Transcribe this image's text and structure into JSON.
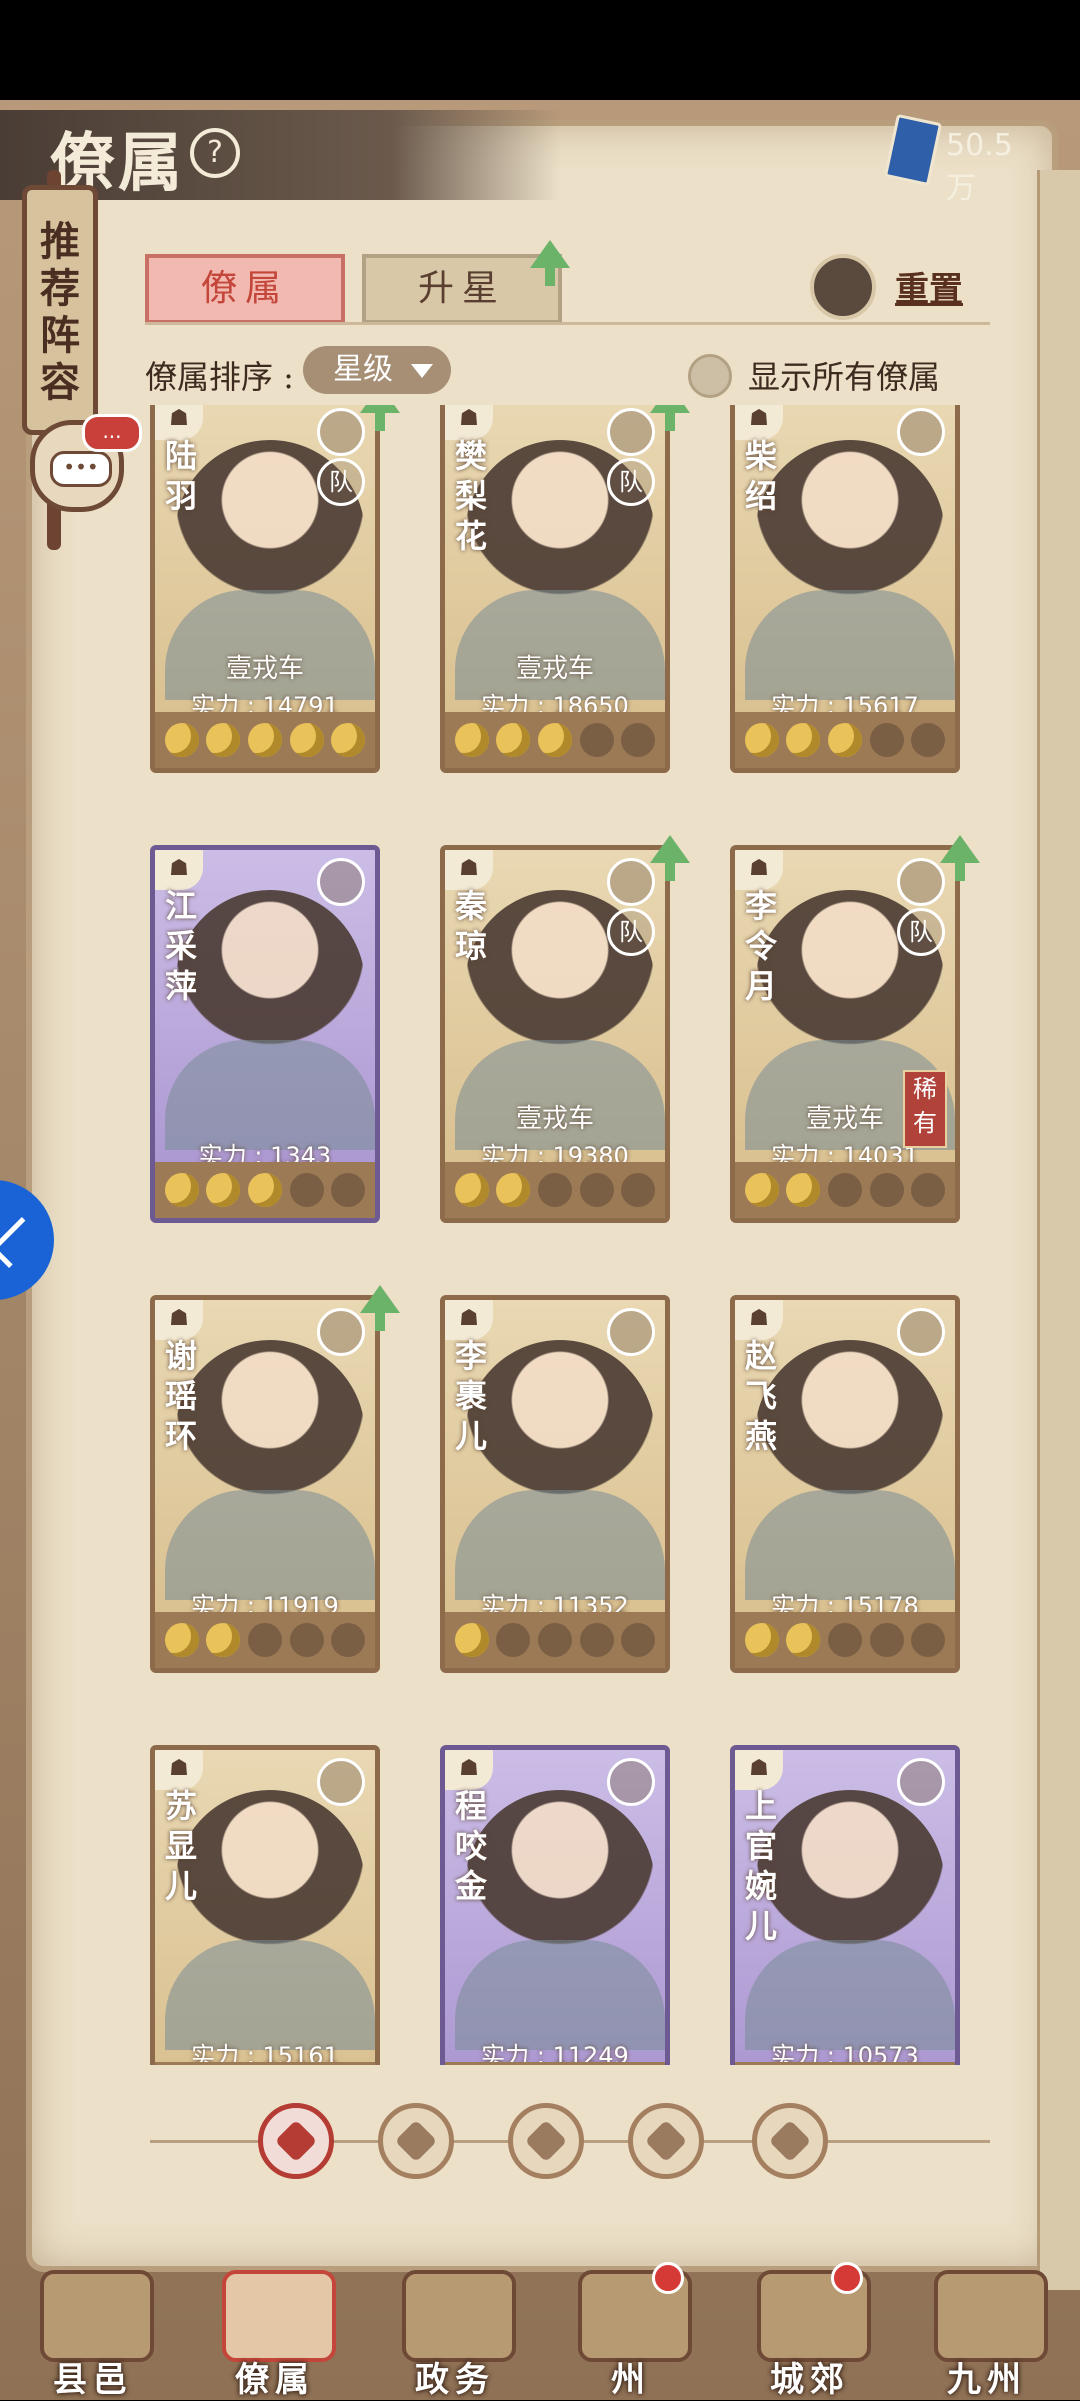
{
  "header": {
    "title": "僚属",
    "help_icon": "question-circle-icon",
    "currency_value": "50.5万"
  },
  "recommend": {
    "label": "推荐阵容",
    "chat_badge": "..."
  },
  "tabs": [
    {
      "label": "僚属",
      "active": true
    },
    {
      "label": "升星",
      "active": false
    }
  ],
  "reset_label": "重置",
  "sort": {
    "label": "僚属排序 :",
    "selected": "星级"
  },
  "show_all_label": "显示所有僚属",
  "cards": [
    {
      "name": "陆羽",
      "team": "壹戎车",
      "power": "实力 : 14791",
      "stars_on": 5,
      "frame": "gold",
      "badge": "队",
      "rare": "",
      "upgrade": true
    },
    {
      "name": "樊梨花",
      "team": "壹戎车",
      "power": "实力 : 18650",
      "stars_on": 3,
      "frame": "gold",
      "badge": "队",
      "rare": "",
      "upgrade": true
    },
    {
      "name": "柴绍",
      "team": "",
      "power": "实力 : 15617",
      "stars_on": 3,
      "frame": "gold",
      "badge": "",
      "rare": "",
      "upgrade": false
    },
    {
      "name": "江采萍",
      "team": "",
      "power": "实力 : 1343",
      "stars_on": 3,
      "frame": "purple",
      "badge": "",
      "rare": "",
      "upgrade": false
    },
    {
      "name": "秦琼",
      "team": "壹戎车",
      "power": "实力 : 19380",
      "stars_on": 2,
      "frame": "gold",
      "badge": "队",
      "rare": "",
      "upgrade": true
    },
    {
      "name": "李令月",
      "team": "壹戎车",
      "power": "实力 : 14031",
      "stars_on": 2,
      "frame": "gold",
      "badge": "队",
      "rare": "稀有",
      "upgrade": true
    },
    {
      "name": "谢瑶环",
      "team": "",
      "power": "实力 : 11919",
      "stars_on": 2,
      "frame": "gold",
      "badge": "",
      "rare": "",
      "upgrade": true
    },
    {
      "name": "李裹儿",
      "team": "",
      "power": "实力 : 11352",
      "stars_on": 1,
      "frame": "gold",
      "badge": "",
      "rare": "",
      "upgrade": false
    },
    {
      "name": "赵飞燕",
      "team": "",
      "power": "实力 : 15178",
      "stars_on": 2,
      "frame": "gold",
      "badge": "",
      "rare": "",
      "upgrade": false
    },
    {
      "name": "苏显儿",
      "team": "",
      "power": "实力 : 15161",
      "stars_on": 0,
      "frame": "gold",
      "badge": "",
      "rare": "",
      "upgrade": false
    },
    {
      "name": "程咬金",
      "team": "",
      "power": "实力 : 11249",
      "stars_on": 0,
      "frame": "purple",
      "badge": "",
      "rare": "",
      "upgrade": false
    },
    {
      "name": "上官婉儿",
      "team": "",
      "power": "实力 : 10573",
      "stars_on": 0,
      "frame": "purple",
      "badge": "",
      "rare": "",
      "upgrade": false
    }
  ],
  "filters": [
    "all-filter-icon",
    "helmet-filter-icon",
    "gourd-filter-icon",
    "fan-filter-icon",
    "beast-filter-icon"
  ],
  "bottom_nav": [
    {
      "label": "县邑",
      "dot": false,
      "active": false
    },
    {
      "label": "僚属",
      "dot": false,
      "active": true
    },
    {
      "label": "政务",
      "dot": false,
      "active": false
    },
    {
      "label": "州",
      "dot": true,
      "active": false
    },
    {
      "label": "城郊",
      "dot": true,
      "active": false
    },
    {
      "label": "九州",
      "dot": false,
      "active": false
    }
  ]
}
